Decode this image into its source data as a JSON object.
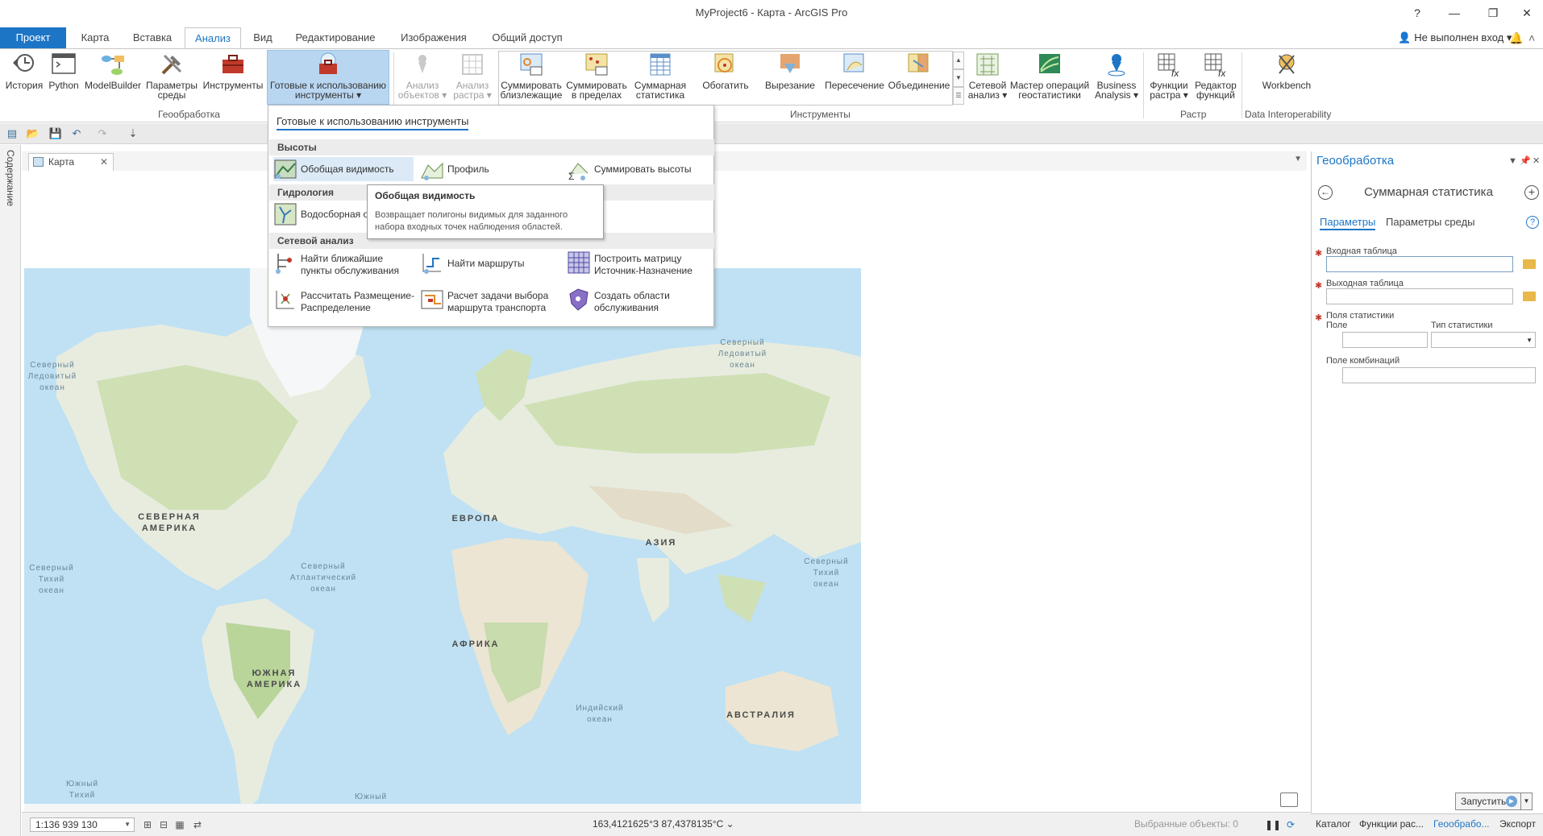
{
  "window": {
    "title": "MyProject6 - Карта - ArcGIS Pro",
    "help": "?",
    "minimize": "—",
    "restore": "❐",
    "close": "✕"
  },
  "tabs": [
    "Проект",
    "Карта",
    "Вставка",
    "Анализ",
    "Вид",
    "Редактирование",
    "Изображения",
    "Общий доступ"
  ],
  "active_tab": "Анализ",
  "signin": "Не выполнен вход",
  "ribbon": {
    "geoprocessing": {
      "label": "Геообработка",
      "history": "История",
      "python": "Python",
      "modelbuilder": "ModelBuilder",
      "env1": "Параметры",
      "env2": "среды",
      "tools": "Инструменты",
      "ready1": "Готовые к использованию",
      "ready2": "инструменты ▾"
    },
    "tools": {
      "label": "Инструменты",
      "feat1": "Анализ",
      "feat2": "объектов ▾",
      "rast1": "Анализ",
      "rast2": "растра ▾",
      "sumnear1": "Суммировать",
      "sumnear2": "близлежащие",
      "sumwithin1": "Суммировать",
      "sumwithin2": "в пределах",
      "sumstat1": "Суммарная",
      "sumstat2": "статистика",
      "buffer": "Обогатить",
      "clip": "Вырезание",
      "intersect": "Пересечение",
      "union": "Объединение",
      "network1": "Сетевой",
      "network2": "анализ ▾",
      "geostat1": "Мастер операций",
      "geostat2": "геостатистики",
      "ba1": "Business",
      "ba2": "Analysis ▾"
    },
    "raster": {
      "label": "Растр",
      "func1": "Функции",
      "func2": "растра ▾",
      "editor1": "Редактор",
      "editor2": "функций"
    },
    "interop": {
      "label": "Data Interoperability",
      "workbench": "Workbench"
    }
  },
  "contents_label": "Содержание",
  "map_tab": "Карта",
  "map_labels": {
    "arctic_w1": "Северный",
    "arctic_w2": "Ледовитый",
    "arctic_w3": "океан",
    "arctic_e1": "Северный",
    "arctic_e2": "Ледовитый",
    "arctic_e3": "океан",
    "na1": "СЕВЕРНАЯ",
    "na2": "АМЕРИКА",
    "europe": "ЕВРОПА",
    "asia": "АЗИЯ",
    "npac_w1": "Северный",
    "npac_w2": "Тихий",
    "npac_w3": "океан",
    "natl1": "Северный",
    "natl2": "Атлантический",
    "natl3": "океан",
    "npac_e1": "Северный",
    "npac_e2": "Тихий",
    "npac_e3": "океан",
    "africa": "АФРИКА",
    "sa1": "ЮЖНАЯ",
    "sa2": "АМЕРИКА",
    "indian1": "Индийский",
    "indian2": "океан",
    "australia": "АВСТРАЛИЯ",
    "spac1": "Южный",
    "spac2": "Тихий",
    "south": "Южный"
  },
  "dropdown": {
    "title": "Готовые к использованию инструменты",
    "cat_elev": "Высоты",
    "viewshed": "Обобщая видимость",
    "profile": "Профиль",
    "sum_elev": "Суммировать высоты",
    "cat_hydro": "Гидрология",
    "watershed": "Водосборная о",
    "cat_network": "Сетевой анализ",
    "closest1": "Найти ближайшие",
    "closest2": "пункты обслуживания",
    "routes": "Найти маршруты",
    "od1": "Построить матрицу",
    "od2": "Источник-Назначение",
    "la1": "Рассчитать Размещение-",
    "la2": "Распределение",
    "vrp1": "Расчет задачи выбора",
    "vrp2": "маршрута транспорта",
    "sa1": "Создать области",
    "sa2": "обслуживания"
  },
  "tooltip": {
    "title": "Обобщая видимость",
    "line1": "Возвращает полигоны видимых для заданного",
    "line2": "набора входных точек наблюдения областей."
  },
  "gp": {
    "header": "Геообработка",
    "tool": "Суммарная статистика",
    "tab_params": "Параметры",
    "tab_env": "Параметры среды",
    "in_table": "Входная таблица",
    "out_table": "Выходная таблица",
    "stat_fields": "Поля статистики",
    "field": "Поле",
    "stat_type": "Тип статистики",
    "case_field": "Поле комбинаций",
    "run": "Запустить"
  },
  "status": {
    "scale": "1:136 939 130",
    "coords": "163,4121625°З 87,4378135°С",
    "selected": "Выбранные объекты: 0"
  },
  "bottom_tabs": [
    "Каталог",
    "Функции рас...",
    "Геообрабо...",
    "Экспорт"
  ],
  "colors": {
    "accent": "#1d75c6",
    "ocean": "#bfe1f3",
    "land": "#eef1ea",
    "forest": "#cfe0b5"
  }
}
